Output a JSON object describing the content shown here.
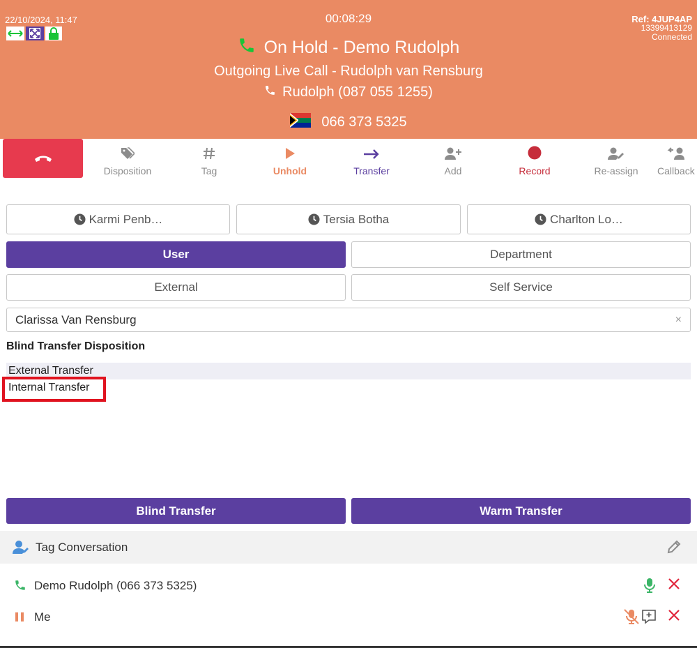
{
  "header": {
    "datetime": "22/10/2024, 11:47",
    "timer": "00:08:29",
    "status": "On Hold - Demo Rudolph",
    "subtitle": "Outgoing Live Call - Rudolph van Rensburg",
    "caller": "Rudolph (087 055 1255)",
    "number": "066 373 5325",
    "ref": "Ref: 4JUP4AP",
    "ref_id": "13399413129",
    "connection": "Connected",
    "colors": {
      "background": "#ea8a63",
      "accent_purple": "#5b3fa0",
      "green": "#19c437"
    },
    "status_icons": [
      "resize-arrows-icon",
      "fullscreen-icon",
      "lock-icon"
    ]
  },
  "toolbar": {
    "items": [
      {
        "label": "Disposition",
        "icon": "tags-icon"
      },
      {
        "label": "Tag",
        "icon": "hash-icon"
      },
      {
        "label": "Unhold",
        "icon": "play-icon"
      },
      {
        "label": "Transfer",
        "icon": "arrow-right-icon"
      },
      {
        "label": "Add",
        "icon": "user-plus-icon"
      },
      {
        "label": "Record",
        "icon": "record-icon"
      },
      {
        "label": "Re-assign",
        "icon": "user-edit-icon"
      },
      {
        "label": "Callback",
        "icon": "callback-icon"
      }
    ]
  },
  "recent": [
    "Karmi Penb…",
    "Tersia Botha",
    "Charlton Lo…"
  ],
  "transfer_types": {
    "user": "User",
    "department": "Department",
    "external": "External",
    "self_service": "Self Service",
    "selected": "User"
  },
  "search": {
    "value": "Clarissa Van Rensburg",
    "clear": "×"
  },
  "disposition": {
    "title": "Blind Transfer Disposition",
    "options": [
      "External Transfer",
      "Internal Transfer"
    ],
    "selected": "Internal Transfer"
  },
  "actions": {
    "blind": "Blind Transfer",
    "warm": "Warm Transfer"
  },
  "tag_conversation": "Tag Conversation",
  "participants": [
    {
      "name": "Demo Rudolph (066 373 5325)"
    },
    {
      "name": "Me"
    }
  ]
}
